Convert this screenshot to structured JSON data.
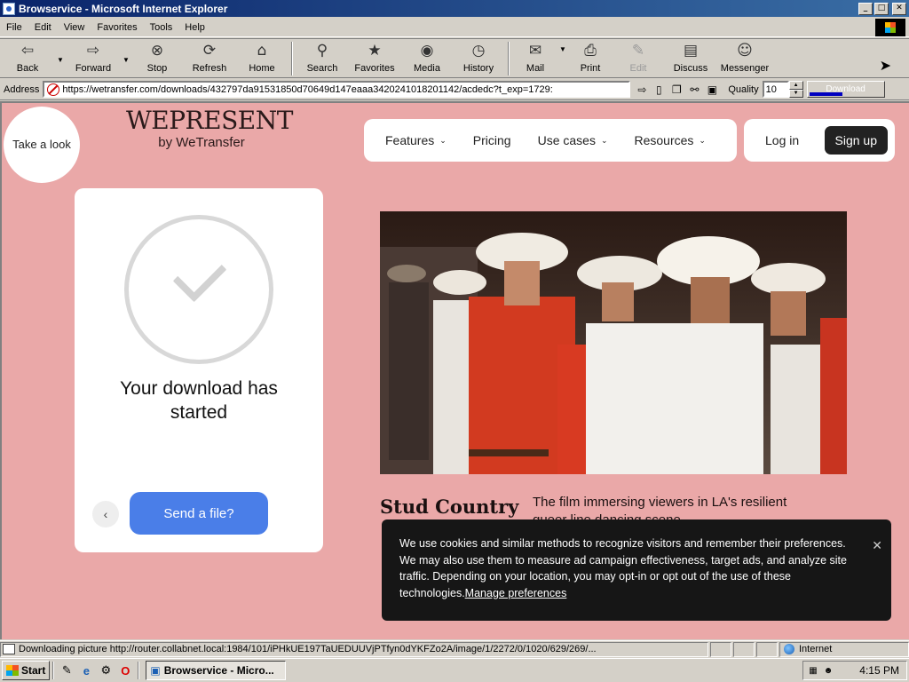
{
  "window": {
    "title": "Browservice - Microsoft Internet Explorer",
    "buttons": {
      "minimize": "_",
      "maximize": "□",
      "close": "✕"
    }
  },
  "menu": [
    {
      "label": "File",
      "key": "F",
      "rest": "ile"
    },
    {
      "label": "Edit",
      "key": "E",
      "rest": "dit"
    },
    {
      "label": "View",
      "key": "V",
      "rest": "iew"
    },
    {
      "label": "Favorites",
      "key": "F",
      "rest": "avorites",
      "prefix": "F"
    },
    {
      "label": "Tools",
      "key": "T",
      "rest": "ools"
    },
    {
      "label": "Help",
      "key": "H",
      "rest": "elp"
    }
  ],
  "toolbar": {
    "back": "Back",
    "forward": "Forward",
    "stop": "Stop",
    "refresh": "Refresh",
    "home": "Home",
    "search": "Search",
    "favorites": "Favorites",
    "media": "Media",
    "history": "History",
    "mail": "Mail",
    "print": "Print",
    "edit": "Edit",
    "discuss": "Discuss",
    "messenger": "Messenger"
  },
  "address": {
    "label": "Address",
    "url": "https://wetransfer.com/downloads/432797da91531850d70649d147eaaa3420241018201142/acdedc?t_exp=1729:",
    "quality_label": "Quality",
    "quality_value": "10",
    "download_label": "Download",
    "download_progress": 0.45
  },
  "page": {
    "take_look": "Take a look",
    "brand_logo": "WEPRESENT",
    "brand_sub": "by WeTransfer",
    "nav": {
      "features": "Features",
      "pricing": "Pricing",
      "use_cases": "Use cases",
      "resources": "Resources",
      "login": "Log in",
      "signup": "Sign up"
    },
    "download": {
      "heading": "Your download has started",
      "send": "Send a file?"
    },
    "story": {
      "title": "Stud Country",
      "description": "The film immersing viewers in LA's resilient queer line dancing scene"
    },
    "cookie": {
      "text": "We use cookies and similar methods to recognize visitors and remember their preferences. We may also use them to measure ad campaign effectiveness, target ads, and analyze site traffic. Depending on your location, you may opt-in or opt out of the use of these technologies.",
      "link": "Manage preferences"
    }
  },
  "status": {
    "text": "Downloading picture http://router.collabnet.local:1984/101/iPHkUE197TaUEDUUVjPTfyn0dYKFZo2A/image/1/2272/0/1020/629/269/...",
    "zone": "Internet"
  },
  "taskbar": {
    "start": "Start",
    "task": "Browservice - Micro...",
    "clock": "4:15 PM"
  },
  "icons": {
    "back": "arrow-left-icon",
    "forward": "arrow-right-icon",
    "stop": "stop-icon",
    "refresh": "refresh-icon",
    "home": "home-icon",
    "search": "search-icon",
    "favorites": "favorites-icon",
    "media": "media-icon",
    "history": "history-icon",
    "mail": "mail-icon",
    "print": "printer-icon",
    "edit": "edit-icon",
    "discuss": "discuss-icon",
    "messenger": "messenger-icon"
  },
  "colors": {
    "page_bg": "#eaa8a8",
    "send_button": "#4a7ee8",
    "cookie_bg": "#161616",
    "titlebar": "#0a246a"
  }
}
